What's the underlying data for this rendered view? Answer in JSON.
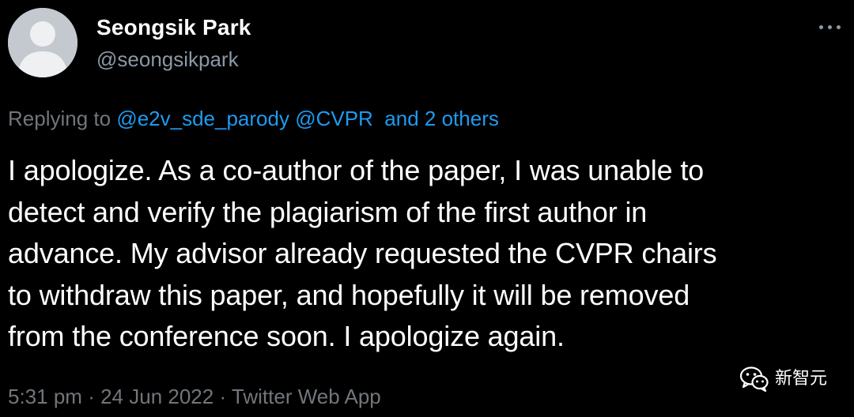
{
  "tweet": {
    "author": {
      "display_name": "Seongsik Park",
      "handle": "@seongsikpark",
      "avatar_icon": "default-user-avatar-icon"
    },
    "more_icon": "more-options-icon",
    "replying_to": {
      "prefix": "Replying to",
      "mention_1": "@e2v_sde_parody",
      "mention_2": "@CVPR",
      "others": "and 2 others"
    },
    "text_lines": [
      "I apologize. As a co-author of the paper, I was unable to",
      "detect and verify the plagiarism of the first author in",
      "advance. My advisor already requested the CVPR chairs",
      "to withdraw this paper, and hopefully it will be removed",
      "from the conference soon. I apologize again."
    ],
    "meta": {
      "time": "5:31 pm",
      "separator": "·",
      "date": "24 Jun 2022",
      "source": "Twitter Web App"
    }
  },
  "watermark": {
    "icon": "wechat-icon",
    "text": "新智元"
  },
  "colors": {
    "background": "#000000",
    "text": "#ffffff",
    "muted": "#71767b",
    "link": "#1d9bf0",
    "avatar_bg": "#c4c9d0",
    "avatar_fg": "#eef0f2"
  }
}
